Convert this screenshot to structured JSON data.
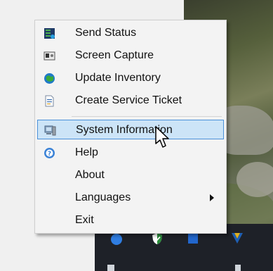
{
  "menu": {
    "items": [
      {
        "label": "Send Status",
        "icon": "send-status-icon"
      },
      {
        "label": "Screen Capture",
        "icon": "screen-capture-icon"
      },
      {
        "label": "Update Inventory",
        "icon": "update-inventory-icon"
      },
      {
        "label": "Create Service Ticket",
        "icon": "service-ticket-icon"
      },
      {
        "label": "System Information",
        "icon": "system-information-icon",
        "highlighted": true
      },
      {
        "label": "Help",
        "icon": "help-icon"
      },
      {
        "label": "About",
        "icon": ""
      },
      {
        "label": "Languages",
        "icon": "",
        "has_submenu": true
      },
      {
        "label": "Exit",
        "icon": ""
      }
    ]
  },
  "colors": {
    "highlight_bg": "#cce4f7",
    "highlight_border": "#4a90d9",
    "menu_bg": "#f3f3f3"
  }
}
